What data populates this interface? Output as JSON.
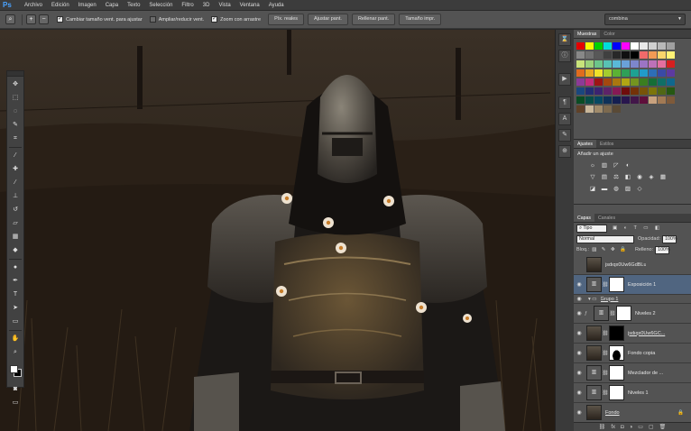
{
  "menubar": {
    "app_logo": "Ps",
    "items": [
      "Archivo",
      "Edición",
      "Imagen",
      "Capa",
      "Texto",
      "Selección",
      "Filtro",
      "3D",
      "Vista",
      "Ventana",
      "Ayuda"
    ]
  },
  "options": {
    "zoom_in_icon": "zoom-in-icon",
    "zoom_out_icon": "zoom-out-icon",
    "resize_windows": "Cambiar tamaño vent. para ajustar",
    "resize_windows_checked": true,
    "zoom_all": "Ampliar/reducir vent.",
    "zoom_all_checked": false,
    "scrubby_zoom": "Zoom con arrastre",
    "scrubby_zoom_checked": true,
    "actual_pixels": "Píx. reales",
    "fit_screen": "Ajustar pant.",
    "fill_screen": "Rellenar pant.",
    "print_size": "Tamaño impr.",
    "workspace": "combina"
  },
  "panels": {
    "swatches_tab": "Muestras",
    "color_tab": "Color",
    "adjust_tab": "Ajustes",
    "styles_tab": "Estilos",
    "adjust_add": "Añadir un ajuste",
    "layers_tab": "Capas",
    "channels_tab": "Canales",
    "kind": "Tipo",
    "blend_mode": "Normal",
    "opacity_label": "Opacidad:",
    "opacity": "100%",
    "lock_label": "Bloq.:",
    "fill_label": "Relleno:",
    "fill": "100%"
  },
  "layers": [
    {
      "name": "jsdıqx0Uw6GdBLuDJ5m-1-...",
      "visible": false,
      "thumb": "photo",
      "link": false,
      "mask": false,
      "indent": 0,
      "active": false
    },
    {
      "name": "Exposición 1",
      "visible": true,
      "thumb": "adjust",
      "link": true,
      "mask": "white",
      "indent": 0,
      "active": true
    },
    {
      "name": "Grupo 1",
      "visible": true,
      "thumb": "folder",
      "link": false,
      "mask": false,
      "indent": 0,
      "active": false
    },
    {
      "name": "Niveles 2",
      "visible": true,
      "thumb": "adjust",
      "link": true,
      "mask": "white",
      "indent": 1,
      "active": false
    },
    {
      "name": "jsdıqx0Uw6GC...",
      "visible": true,
      "thumb": "photo",
      "link": true,
      "mask": "black",
      "indent": 0,
      "active": false
    },
    {
      "name": "Fondo copia",
      "visible": true,
      "thumb": "photo",
      "link": true,
      "mask": "figure",
      "indent": 0,
      "active": false
    },
    {
      "name": "Mezclador de ...",
      "visible": true,
      "thumb": "adjust",
      "link": true,
      "mask": "white",
      "indent": 0,
      "active": false
    },
    {
      "name": "Niveles 1",
      "visible": true,
      "thumb": "adjust",
      "link": true,
      "mask": "white",
      "indent": 0,
      "active": false
    },
    {
      "name": "Fondo",
      "visible": true,
      "thumb": "photo",
      "link": false,
      "mask": false,
      "indent": 0,
      "active": false
    }
  ],
  "swatch_colors": [
    "#e40000",
    "#f9f900",
    "#00d100",
    "#00dcdc",
    "#0000ff",
    "#ff00ff",
    "#ffffff",
    "#e8e8e8",
    "#d0d0d0",
    "#b8b8b8",
    "#a0a0a0",
    "#888888",
    "#707070",
    "#585858",
    "#404040",
    "#282828",
    "#101010",
    "#000000",
    "#f06a6a",
    "#f29a55",
    "#f9d56b",
    "#fff275",
    "#c8e37a",
    "#9bd17a",
    "#6cc58a",
    "#58c1b4",
    "#5ab9d8",
    "#6aa1d8",
    "#7d86cc",
    "#9b74c4",
    "#bd71b8",
    "#e36f9f",
    "#d61f1f",
    "#e06c1e",
    "#e8a821",
    "#efe22a",
    "#a4cc2f",
    "#5bb234",
    "#2ea058",
    "#1ea193",
    "#219bc9",
    "#2d6eb7",
    "#3a4aa6",
    "#5d3aa0",
    "#8d3a97",
    "#c22c7a",
    "#9d1414",
    "#a4480f",
    "#aa7710",
    "#b0a514",
    "#749420",
    "#3a7e20",
    "#156e36",
    "#0f6f66",
    "#10678d",
    "#1a477e",
    "#222d73",
    "#3b2370",
    "#5e2368",
    "#871955",
    "#6f0c0c",
    "#743208",
    "#785409",
    "#7c750a",
    "#516715",
    "#265813",
    "#0a4c24",
    "#074d47",
    "#074862",
    "#0f3159",
    "#151f51",
    "#29164e",
    "#421649",
    "#5f0f3b",
    "#c9a27e",
    "#a27a54",
    "#7e5a3a",
    "#5f4128",
    "#c9b79a",
    "#a08b6b",
    "#7d6a4f",
    "#5a4a36"
  ],
  "adjust_icons": [
    [
      "brightness-icon",
      "levels-icon",
      "curves-icon",
      "exposure-icon"
    ],
    [
      "vibrance-icon",
      "hue-icon",
      "balance-icon",
      "bw-icon",
      "photo-filter-icon",
      "mixer-icon",
      "lookup-icon"
    ],
    [
      "invert-icon",
      "posterize-icon",
      "threshold-icon",
      "gradient-map-icon",
      "selective-color-icon"
    ]
  ],
  "toolbar": [
    "move-icon",
    "marquee-icon",
    "lasso-icon",
    "quick-select-icon",
    "crop-icon",
    "eyedropper-icon",
    "heal-icon",
    "brush-icon",
    "stamp-icon",
    "history-brush-icon",
    "eraser-icon",
    "gradient-icon",
    "blur-icon",
    "dodge-icon",
    "pen-icon",
    "type-icon",
    "path-select-icon",
    "shape-icon",
    "hand-icon",
    "zoom-icon"
  ],
  "right_icons": [
    "history-icon",
    "info-icon",
    "actions-icon",
    "paragraph-icon",
    "character-icon",
    "brushes-icon",
    "clone-source-icon"
  ]
}
